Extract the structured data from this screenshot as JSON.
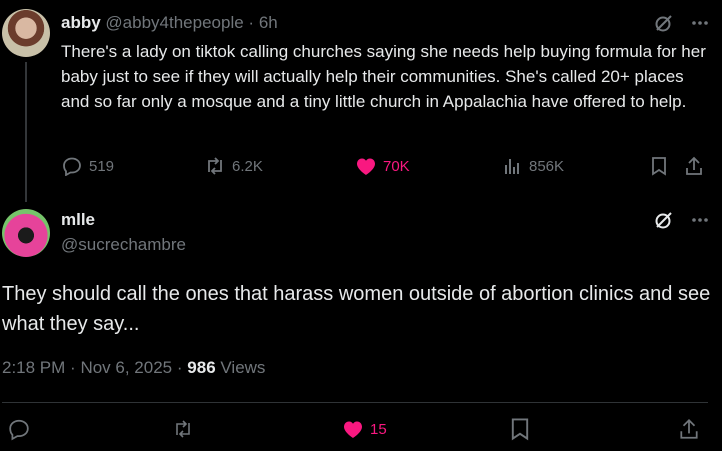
{
  "parent": {
    "name": "abby",
    "handle": "@abby4thepeople",
    "separator": "·",
    "time": "6h",
    "text": "There's a lady on tiktok calling churches saying she needs help buying formula for her baby just to see if they will actually help their communities. She's called 20+ places and so far only a mosque and a tiny little church in Appalachia have offered to help.",
    "stats": {
      "replies": "519",
      "reposts": "6.2K",
      "likes": "70K",
      "views": "856K"
    }
  },
  "reply": {
    "name": "mlle",
    "handle": "@sucrechambre",
    "text": "They should call the ones that harass women outside of abortion clinics and see what they say...",
    "time": "2:18 PM",
    "sep1": "·",
    "date": "Nov 6, 2025",
    "sep2": "·",
    "views_count": "986",
    "views_label": "Views",
    "likes": "15"
  },
  "icons": {
    "grok": "grok-icon",
    "more": "more-icon",
    "reply": "reply-icon",
    "repost": "repost-icon",
    "like": "heart-icon",
    "views": "views-icon",
    "bookmark": "bookmark-icon",
    "share": "share-icon"
  },
  "colors": {
    "background": "#000000",
    "text": "#e7e9ea",
    "muted": "#71767b",
    "like": "#f91880",
    "divider": "#2f3336"
  }
}
